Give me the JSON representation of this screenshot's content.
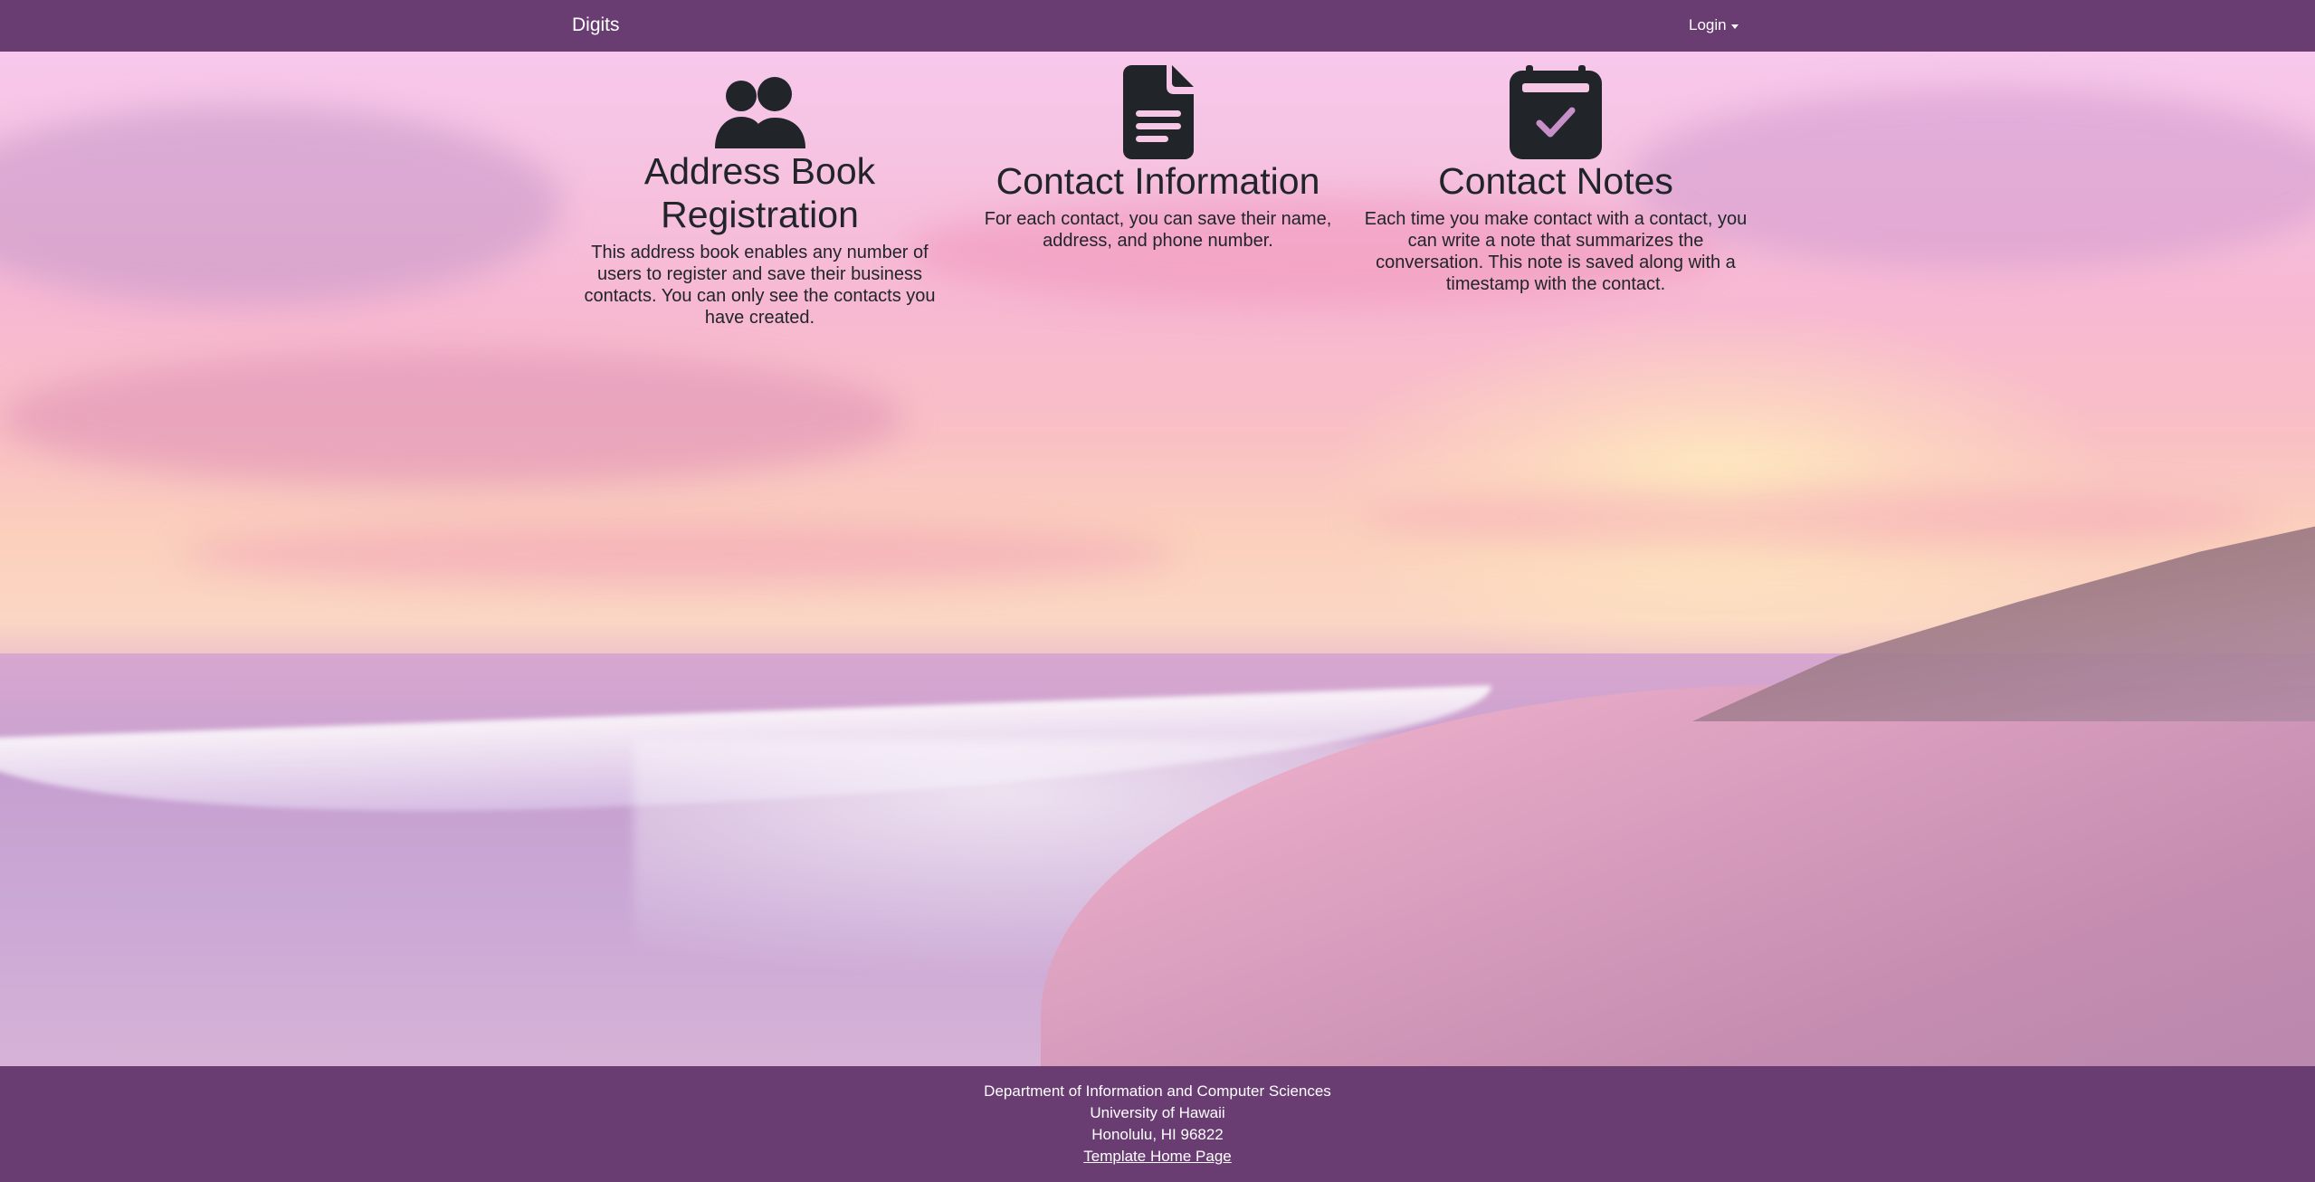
{
  "navbar": {
    "brand": "Digits",
    "login_label": "Login"
  },
  "features": [
    {
      "icon": "users-icon",
      "title": "Address Book Registration",
      "description": "This address book enables any number of users to register and save their business contacts. You can only see the contacts you have created."
    },
    {
      "icon": "file-document-icon",
      "title": "Contact Information",
      "description": "For each contact, you can save their name, address, and phone number."
    },
    {
      "icon": "calendar-check-icon",
      "title": "Contact Notes",
      "description": "Each time you make contact with a contact, you can write a note that summarizes the conversation. This note is saved along with a timestamp with the contact."
    }
  ],
  "footer": {
    "line1": "Department of Information and Computer Sciences",
    "line2": "University of Hawaii",
    "line3": "Honolulu, HI 96822",
    "link_label": "Template Home Page"
  },
  "colors": {
    "navbar_bg": "#693c72",
    "footer_bg": "#693c72",
    "icon_color": "#212529"
  }
}
